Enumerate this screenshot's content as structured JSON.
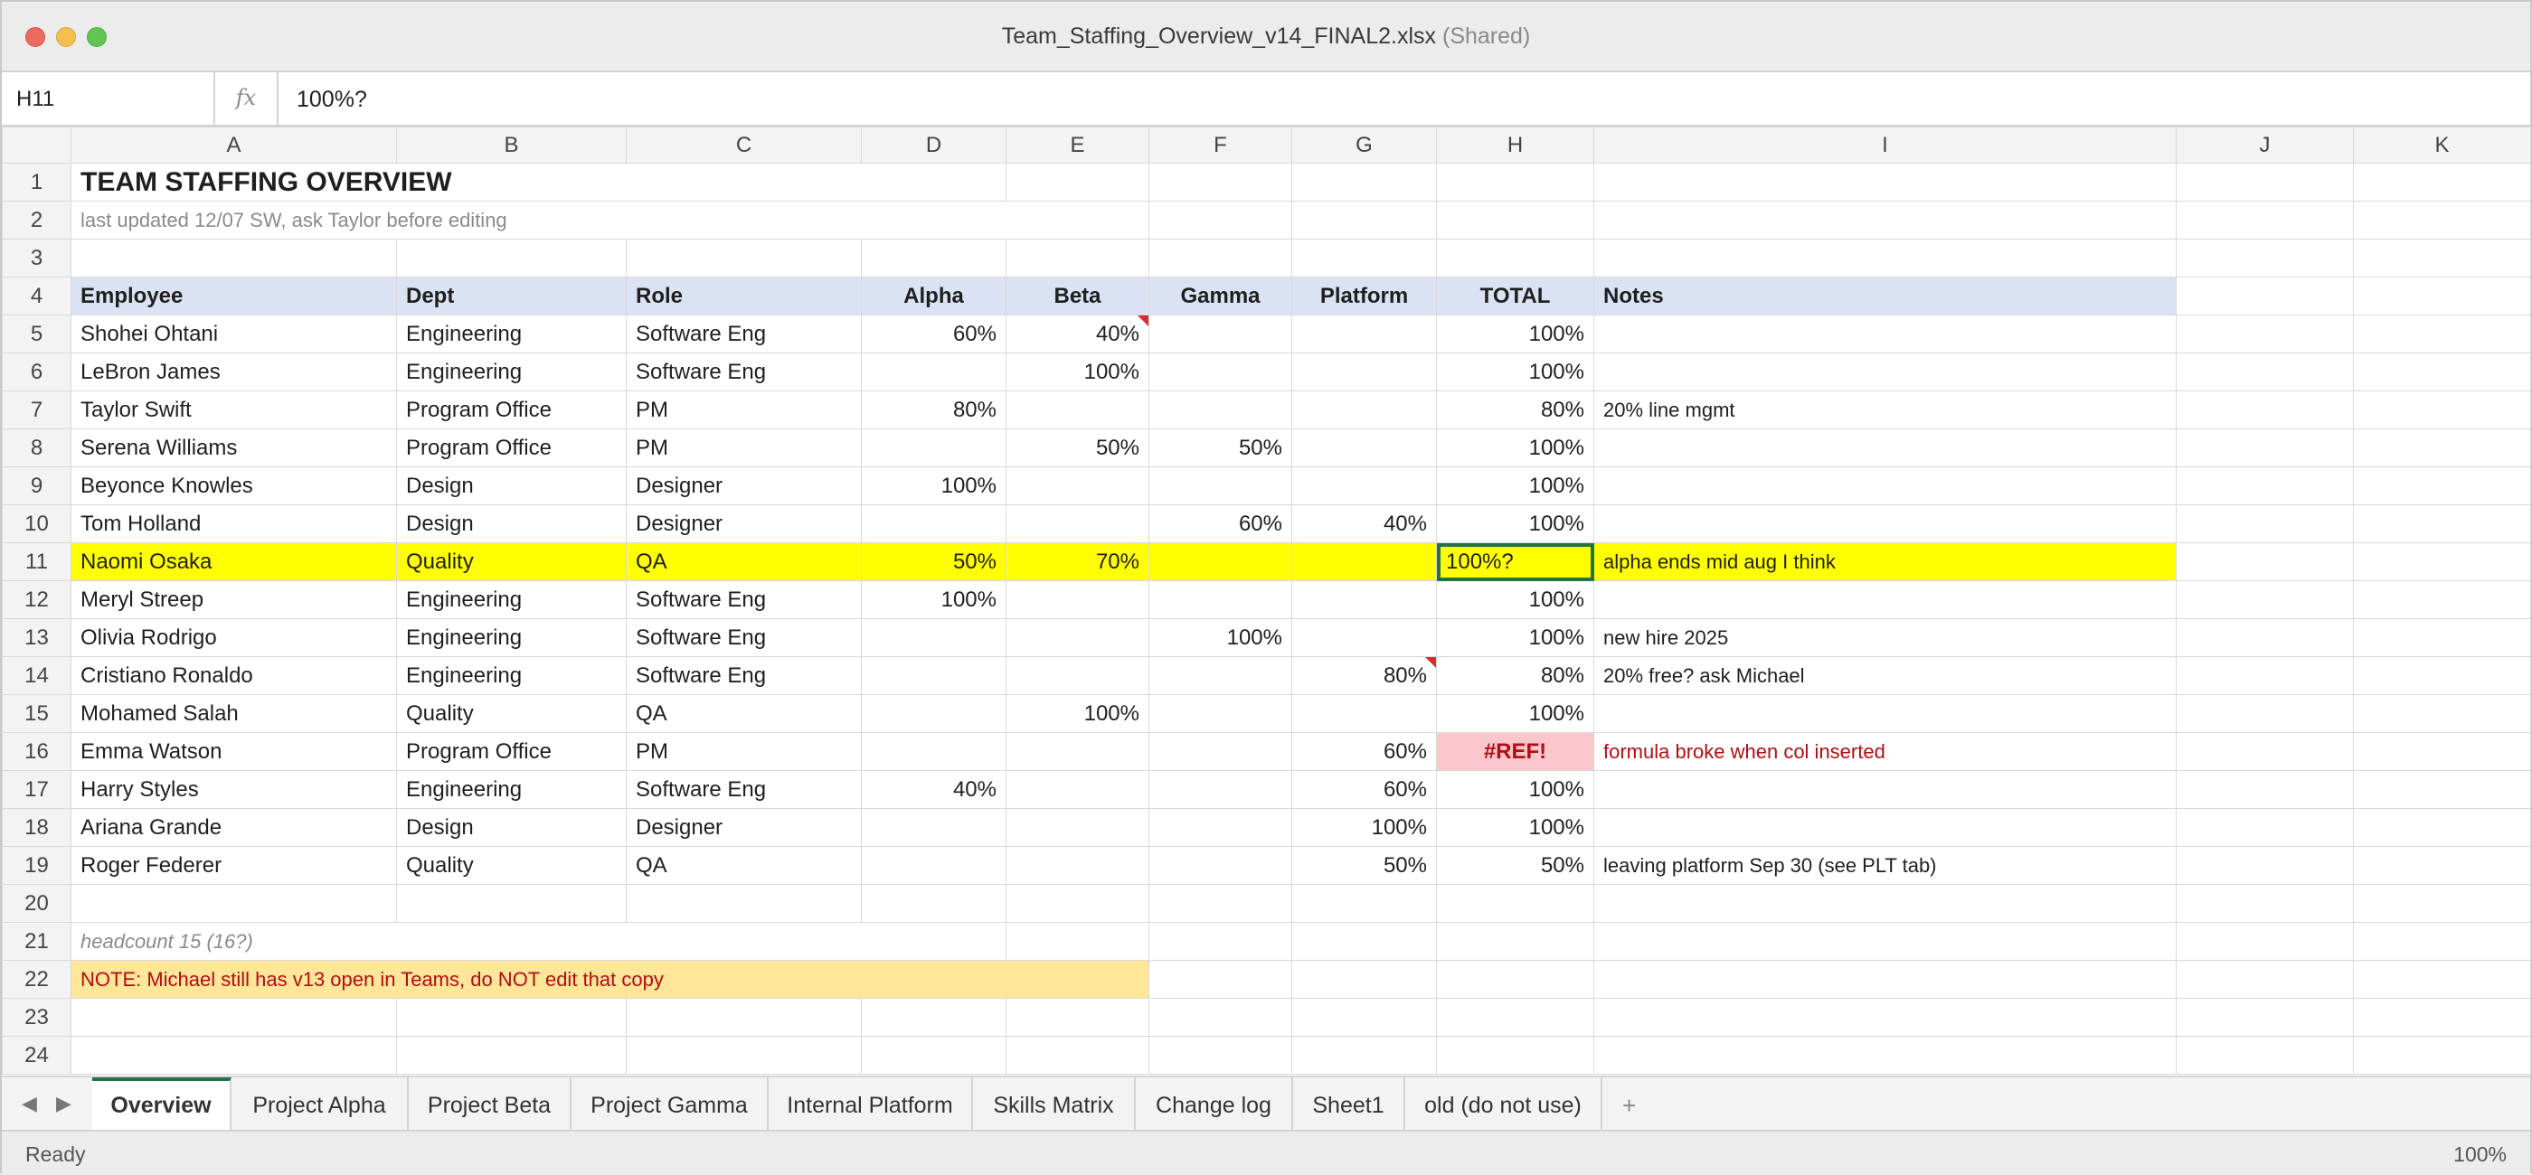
{
  "window": {
    "filename": "Team_Staffing_Overview_v14_FINAL2.xlsx",
    "shared_label": "(Shared)"
  },
  "formula_bar": {
    "cell_ref": "H11",
    "fx_label": "fx",
    "value": "100%?"
  },
  "columns": [
    "A",
    "B",
    "C",
    "D",
    "E",
    "F",
    "G",
    "H",
    "I",
    "J",
    "K"
  ],
  "rows": {
    "r1": {
      "num": "1",
      "title": "TEAM STAFFING OVERVIEW"
    },
    "r2": {
      "num": "2",
      "subtitle": "last updated 12/07 SW, ask Taylor before editing"
    },
    "r3": {
      "num": "3"
    },
    "r4": {
      "num": "4",
      "headers": [
        "Employee",
        "Dept",
        "Role",
        "Alpha",
        "Beta",
        "Gamma",
        "Platform",
        "TOTAL",
        "Notes"
      ]
    },
    "data": [
      {
        "num": "5",
        "cells": [
          "Shohei Ohtani",
          "Engineering",
          "Software Eng",
          "60%",
          "40%",
          "",
          "",
          "100%",
          ""
        ]
      },
      {
        "num": "6",
        "cells": [
          "LeBron James",
          "Engineering",
          "Software Eng",
          "",
          "100%",
          "",
          "",
          "100%",
          ""
        ]
      },
      {
        "num": "7",
        "cells": [
          "Taylor Swift",
          "Program Office",
          "PM",
          "80%",
          "",
          "",
          "",
          "80%",
          "20% line mgmt"
        ]
      },
      {
        "num": "8",
        "cells": [
          "Serena Williams",
          "Program Office",
          "PM",
          "",
          "50%",
          "50%",
          "",
          "100%",
          ""
        ]
      },
      {
        "num": "9",
        "cells": [
          "Beyonce Knowles",
          "Design",
          "Designer",
          "100%",
          "",
          "",
          "",
          "100%",
          ""
        ]
      },
      {
        "num": "10",
        "cells": [
          "Tom Holland",
          "Design",
          "Designer",
          "",
          "",
          "60%",
          "40%",
          "100%",
          ""
        ]
      },
      {
        "num": "11",
        "cells": [
          "Naomi Osaka",
          "Quality",
          "QA",
          "50%",
          "70%",
          "",
          "",
          "100%?",
          "alpha ends mid aug I think"
        ]
      },
      {
        "num": "12",
        "cells": [
          "Meryl Streep",
          "Engineering",
          "Software Eng",
          "100%",
          "",
          "",
          "",
          "100%",
          ""
        ]
      },
      {
        "num": "13",
        "cells": [
          "Olivia Rodrigo",
          "Engineering",
          "Software Eng",
          "",
          "",
          "100%",
          "",
          "100%",
          "new hire 2025"
        ]
      },
      {
        "num": "14",
        "cells": [
          "Cristiano Ronaldo",
          "Engineering",
          "Software Eng",
          "",
          "",
          "",
          "80%",
          "80%",
          "20% free? ask Michael"
        ]
      },
      {
        "num": "15",
        "cells": [
          "Mohamed Salah",
          "Quality",
          "QA",
          "",
          "100%",
          "",
          "",
          "100%",
          ""
        ]
      },
      {
        "num": "16",
        "cells": [
          "Emma Watson",
          "Program Office",
          "PM",
          "",
          "",
          "",
          "60%",
          "#REF!",
          "formula broke when col inserted"
        ]
      },
      {
        "num": "17",
        "cells": [
          "Harry Styles",
          "Engineering",
          "Software Eng",
          "40%",
          "",
          "",
          "60%",
          "100%",
          ""
        ]
      },
      {
        "num": "18",
        "cells": [
          "Ariana Grande",
          "Design",
          "Designer",
          "",
          "",
          "",
          "100%",
          "100%",
          ""
        ]
      },
      {
        "num": "19",
        "cells": [
          "Roger Federer",
          "Quality",
          "QA",
          "",
          "",
          "",
          "50%",
          "50%",
          "leaving platform Sep 30 (see PLT tab)"
        ]
      }
    ],
    "r20": {
      "num": "20"
    },
    "r21": {
      "num": "21",
      "headcount": "headcount 15 (16?)"
    },
    "r22": {
      "num": "22",
      "note": "NOTE: Michael still has v13 open in Teams, do NOT edit that copy"
    },
    "r23": {
      "num": "23"
    },
    "r24": {
      "num": "24"
    }
  },
  "sheet_tabs": [
    "Overview",
    "Project Alpha",
    "Project Beta",
    "Project Gamma",
    "Internal Platform",
    "Skills Matrix",
    "Change log",
    "Sheet1",
    "old (do not use)"
  ],
  "add_sheet_label": "+",
  "nav": {
    "prev": "◀",
    "next": "▶"
  },
  "status": {
    "left": "Ready",
    "zoom": "100%"
  },
  "colors": {
    "selection": "#217346",
    "header_fill": "#dbe2f3",
    "highlight_fill": "#ffff00",
    "error_fill": "#fbc7cd",
    "error_text": "#b10d14",
    "warning_fill": "#ffe699"
  }
}
